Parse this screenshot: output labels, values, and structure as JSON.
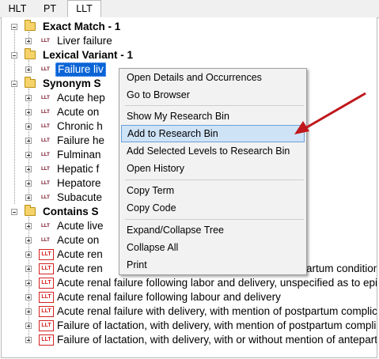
{
  "tabs": [
    "HLT",
    "PT",
    "LLT"
  ],
  "tree": {
    "exact_match": {
      "label": "Exact Match - 1",
      "items": [
        "Liver failure"
      ]
    },
    "lexical_variant": {
      "label": "Lexical Variant - 1",
      "items": [
        "Failure liv"
      ]
    },
    "synonym": {
      "label": "Synonym S",
      "items": [
        "Acute hep",
        "Acute on",
        "Chronic h",
        "Failure he",
        "Fulminan",
        "Hepatic f",
        "Hepatore",
        "Subacute"
      ]
    },
    "contains": {
      "label": "Contains S",
      "items": [
        "Acute live",
        "Acute on",
        "Acute ren",
        "Acute ren",
        "Acute renal failure following labor and delivery, unspecified as to epis",
        "Acute renal failure following labour and delivery",
        "Acute renal failure with delivery, with mention of postpartum complicat",
        "Failure of lactation, with delivery, with mention of postpartum complica",
        "Failure of lactation, with delivery, with or without mention of antepartu"
      ],
      "partial_tail": "artum condition"
    },
    "badge_text": "LLT"
  },
  "context_menu": {
    "items": [
      "Open Details and Occurrences",
      "Go to Browser",
      "Show My Research Bin",
      "Add to Research Bin",
      "Add Selected Levels to Research Bin",
      "Open History",
      "Copy Term",
      "Copy Code",
      "Expand/Collapse Tree",
      "Collapse All",
      "Print"
    ],
    "highlighted": "Add to Research Bin"
  },
  "colors": {
    "selection": "#0a64d6",
    "highlight": "#cfe3f7",
    "arrow": "#c0181c",
    "badge_box": "#d42020"
  }
}
